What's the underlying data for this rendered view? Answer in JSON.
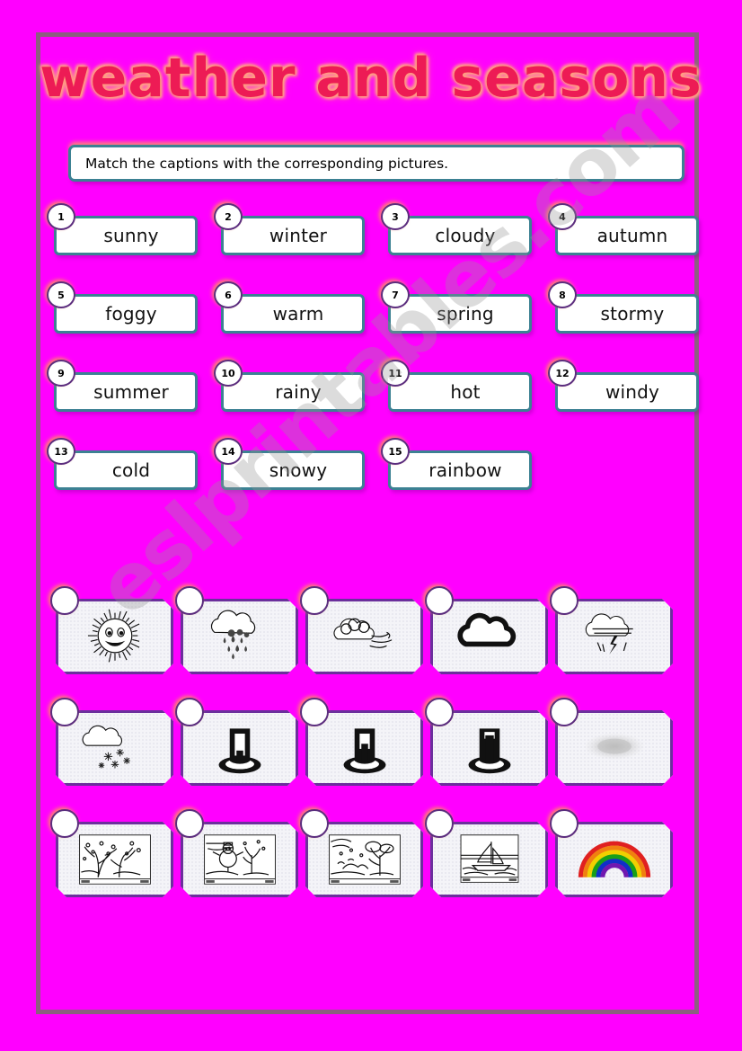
{
  "page": {
    "title": "weather and seasons",
    "background_color": "#FF00FF",
    "frame_color": "#8C5F80",
    "title_color": "#ED1B55",
    "title_glow_color": "#FF9B7A",
    "watermark": "eslprintables.com"
  },
  "instruction": {
    "text": "Match the captions with the corresponding pictures.",
    "border_color": "#3C8193"
  },
  "word_cards": [
    {
      "number": "1",
      "label": "sunny"
    },
    {
      "number": "2",
      "label": "winter"
    },
    {
      "number": "3",
      "label": "cloudy"
    },
    {
      "number": "4",
      "label": "autumn"
    },
    {
      "number": "5",
      "label": "foggy"
    },
    {
      "number": "6",
      "label": "warm"
    },
    {
      "number": "7",
      "label": "spring"
    },
    {
      "number": "8",
      "label": "stormy"
    },
    {
      "number": "9",
      "label": "summer"
    },
    {
      "number": "10",
      "label": "rainy"
    },
    {
      "number": "11",
      "label": "hot"
    },
    {
      "number": "12",
      "label": "windy"
    },
    {
      "number": "13",
      "label": "cold"
    },
    {
      "number": "14",
      "label": "snowy"
    },
    {
      "number": "15",
      "label": "rainbow"
    }
  ],
  "picture_cards": [
    {
      "icon": "sun-smiling-face-icon",
      "answer": ""
    },
    {
      "icon": "rain-cloud-icon",
      "answer": ""
    },
    {
      "icon": "windy-cloud-icon",
      "answer": ""
    },
    {
      "icon": "plain-cloud-icon",
      "answer": ""
    },
    {
      "icon": "storm-lightning-cloud-icon",
      "answer": ""
    },
    {
      "icon": "snow-cloud-icon",
      "answer": ""
    },
    {
      "icon": "thermometer-cold-icon",
      "answer": ""
    },
    {
      "icon": "thermometer-warm-icon",
      "answer": ""
    },
    {
      "icon": "thermometer-hot-icon",
      "answer": ""
    },
    {
      "icon": "fog-mist-icon",
      "answer": ""
    },
    {
      "icon": "spring-blossom-scene-icon",
      "answer": ""
    },
    {
      "icon": "winter-snowman-scene-icon",
      "answer": ""
    },
    {
      "icon": "autumn-tree-scene-icon",
      "answer": ""
    },
    {
      "icon": "summer-sailboat-scene-icon",
      "answer": ""
    },
    {
      "icon": "rainbow-icon",
      "answer": ""
    }
  ],
  "rainbow_colors": [
    "#E02020",
    "#F08010",
    "#F0D000",
    "#18A018",
    "#1030C8",
    "#7018B0"
  ]
}
